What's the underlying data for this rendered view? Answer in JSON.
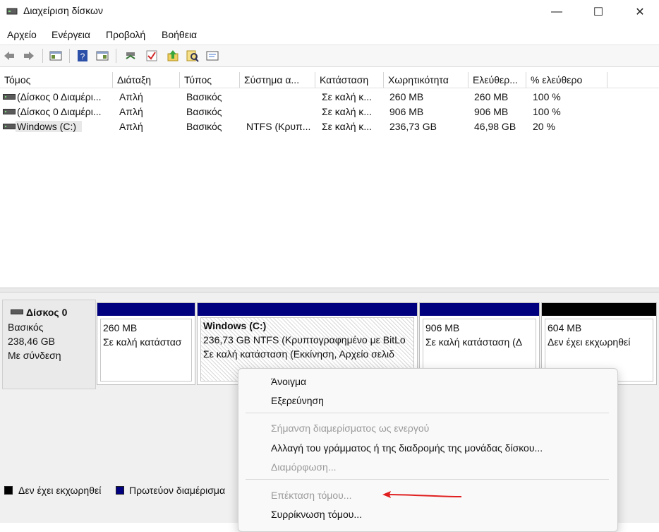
{
  "window": {
    "title": "Διαχείριση δίσκων",
    "minimize": "—",
    "maximize": "☐",
    "close": "✕"
  },
  "menubar": [
    "Αρχείο",
    "Ενέργεια",
    "Προβολή",
    "Βοήθεια"
  ],
  "toolbar": {
    "icons": [
      "back-icon",
      "forward-icon",
      "console-tree-icon",
      "help-icon",
      "action-pane-icon",
      "connect-icon",
      "check-icon",
      "upload-icon",
      "search-icon",
      "properties-icon"
    ]
  },
  "volumes": {
    "columns": [
      "Τόμος",
      "Διάταξη",
      "Τύπος",
      "Σύστημα α...",
      "Κατάσταση",
      "Χωρητικότητα",
      "Ελεύθερ...",
      "% ελεύθερο"
    ],
    "rows": [
      [
        "(Δίσκος 0 Διαμέρι...",
        "Απλή",
        "Βασικός",
        "",
        "Σε καλή κ...",
        "260 MB",
        "260 MB",
        "100 %"
      ],
      [
        "(Δίσκος 0 Διαμέρι...",
        "Απλή",
        "Βασικός",
        "",
        "Σε καλή κ...",
        "906 MB",
        "906 MB",
        "100 %"
      ],
      [
        "Windows (C:)",
        "Απλή",
        "Βασικός",
        "NTFS (Κρυπ...",
        "Σε καλή κ...",
        "236,73 GB",
        "46,98 GB",
        "20 %"
      ]
    ]
  },
  "disk": {
    "name": "Δίσκος 0",
    "type": "Βασικός",
    "size": "238,46 GB",
    "status": "Με σύνδεση"
  },
  "partitions": [
    {
      "title": "",
      "line1": "260 MB",
      "line2": "Σε καλή κατάστασ",
      "color": "#00007f"
    },
    {
      "title": "Windows  (C:)",
      "line1": "236,73 GB NTFS (Κρυπτογραφημένο με BitLo",
      "line2": "Σε καλή κατάσταση (Εκκίνηση, Αρχείο σελιδ",
      "color": "#00007f"
    },
    {
      "title": "",
      "line1": "906 MB",
      "line2": "Σε καλή κατάσταση (Δ",
      "color": "#00007f"
    },
    {
      "title": "",
      "line1": "604 MB",
      "line2": "Δεν έχει εκχωρηθεί",
      "color": "#000000"
    }
  ],
  "legend": [
    {
      "label": "Δεν έχει εκχωρηθεί",
      "color": "#000000"
    },
    {
      "label": "Πρωτεύον διαμέρισμα",
      "color": "#00007f"
    }
  ],
  "context_menu": {
    "items": [
      {
        "label": "Άνοιγμα",
        "enabled": true
      },
      {
        "label": "Εξερεύνηση",
        "enabled": true
      },
      {
        "label": "Σήμανση διαμερίσματος ως ενεργού",
        "enabled": false
      },
      {
        "label": "Αλλαγή  του γράμματος ή της διαδρομής της μονάδας δίσκου...",
        "enabled": true
      },
      {
        "label": "Διαμόρφωση...",
        "enabled": false
      },
      {
        "label": "Επέκταση τόμου...",
        "enabled": false
      },
      {
        "label": "Συρρίκνωση τόμου...",
        "enabled": true
      }
    ]
  },
  "annotation": {
    "arrow_color": "#e02020"
  }
}
